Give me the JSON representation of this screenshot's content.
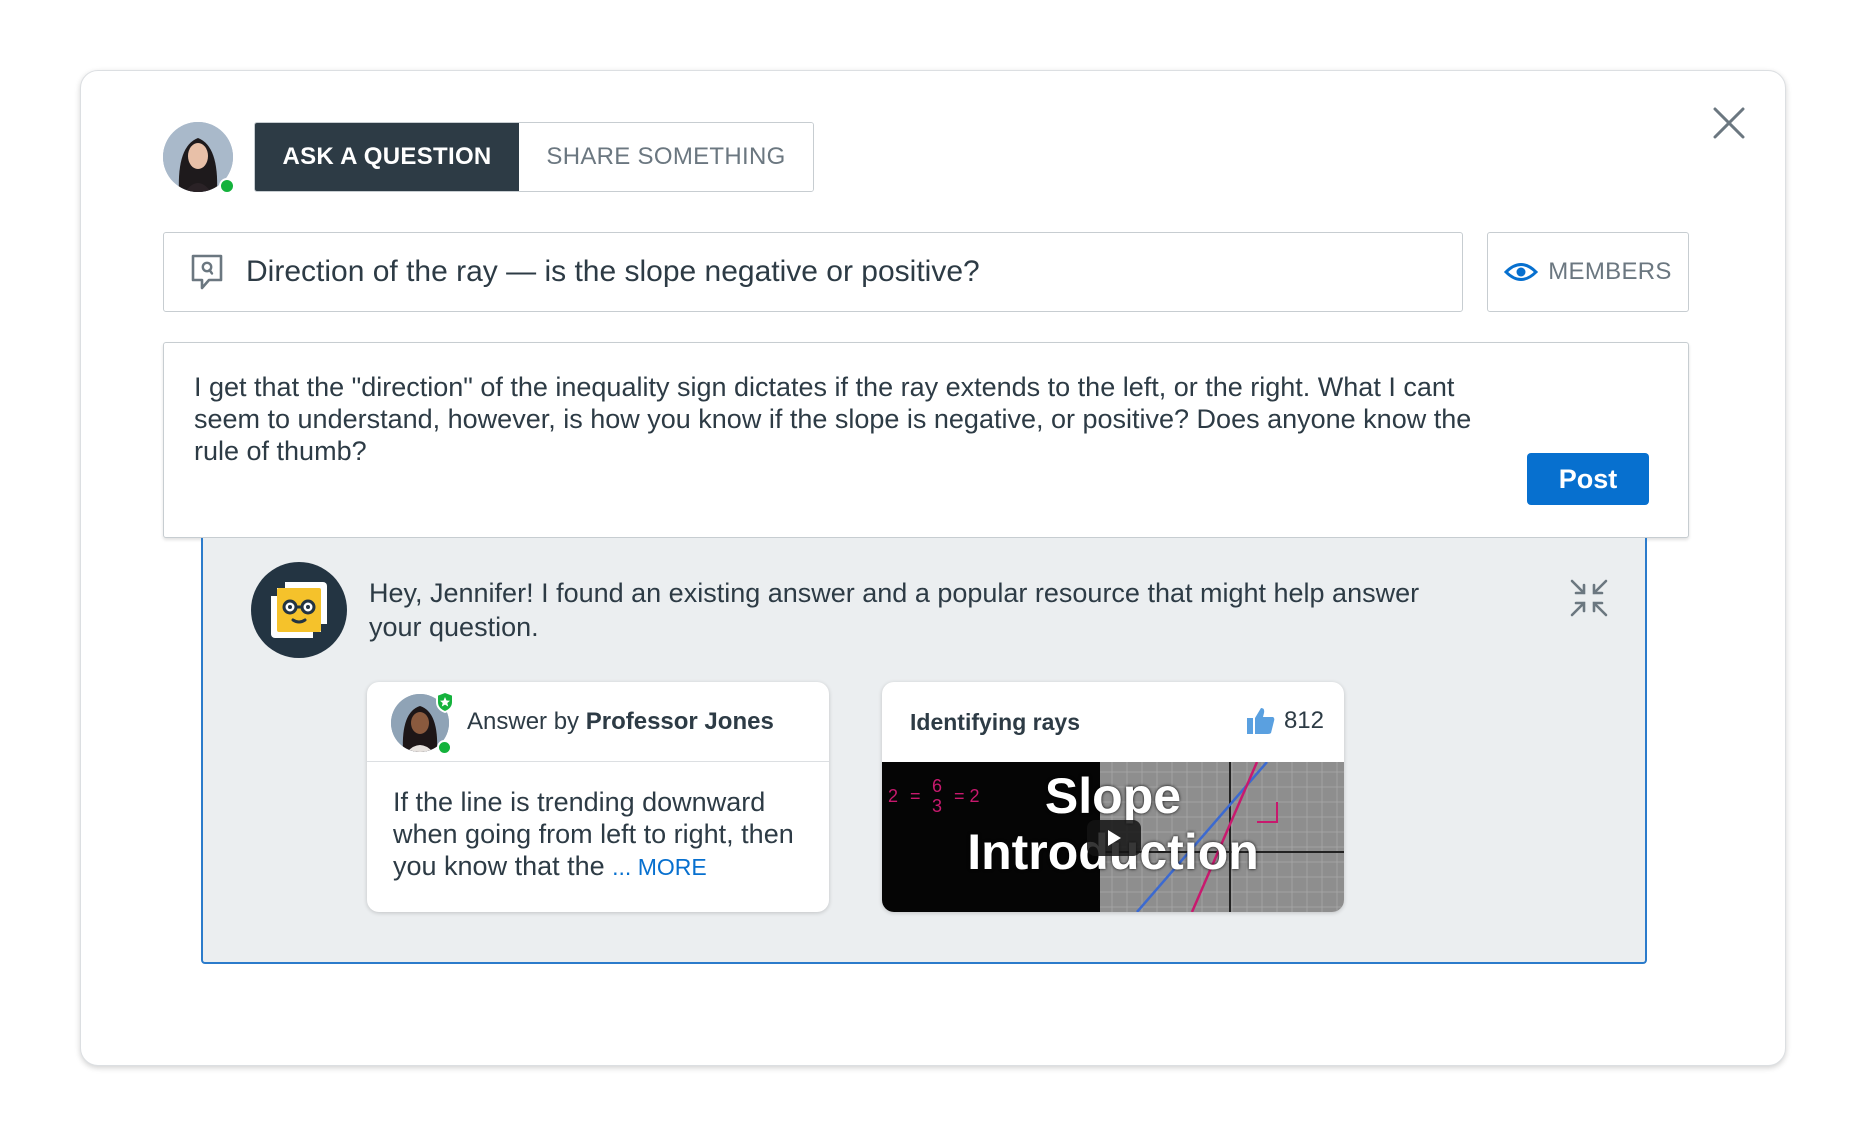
{
  "composer": {
    "tabs": [
      {
        "label": "ASK A QUESTION",
        "active": true
      },
      {
        "label": "SHARE SOMETHING",
        "active": false
      }
    ],
    "title_value": "Direction of the ray — is the slope negative or positive?",
    "visibility_label": "MEMBERS",
    "body_value": "I get that the \"direction\" of the inequality sign dictates if the ray extends to the left, or the right. What I cant seem to understand, however, is how you know if the slope is negative, or positive? Does anyone know the rule of thumb?",
    "post_label": "Post"
  },
  "suggestions": {
    "message": "Hey, Jennifer! I found an existing answer and a popular resource that might help answer your question.",
    "answer": {
      "prefix": "Answer by",
      "author": "Professor Jones",
      "excerpt": "If the line is trending downward when going from left to right, then you know that the",
      "more_label": "... MORE"
    },
    "resource": {
      "title": "Identifying rays",
      "likes": "812",
      "video_title_line1": "Slope",
      "video_title_line2": "Introduction"
    }
  },
  "colors": {
    "accent": "#0770cf",
    "dark": "#2d3b45",
    "online": "#14b23c",
    "panel_bg": "#ebeef0"
  },
  "icons": [
    "close-icon",
    "question-icon",
    "eye-icon",
    "collapse-icon",
    "thumbs-up-icon",
    "play-icon",
    "bot-icon"
  ]
}
